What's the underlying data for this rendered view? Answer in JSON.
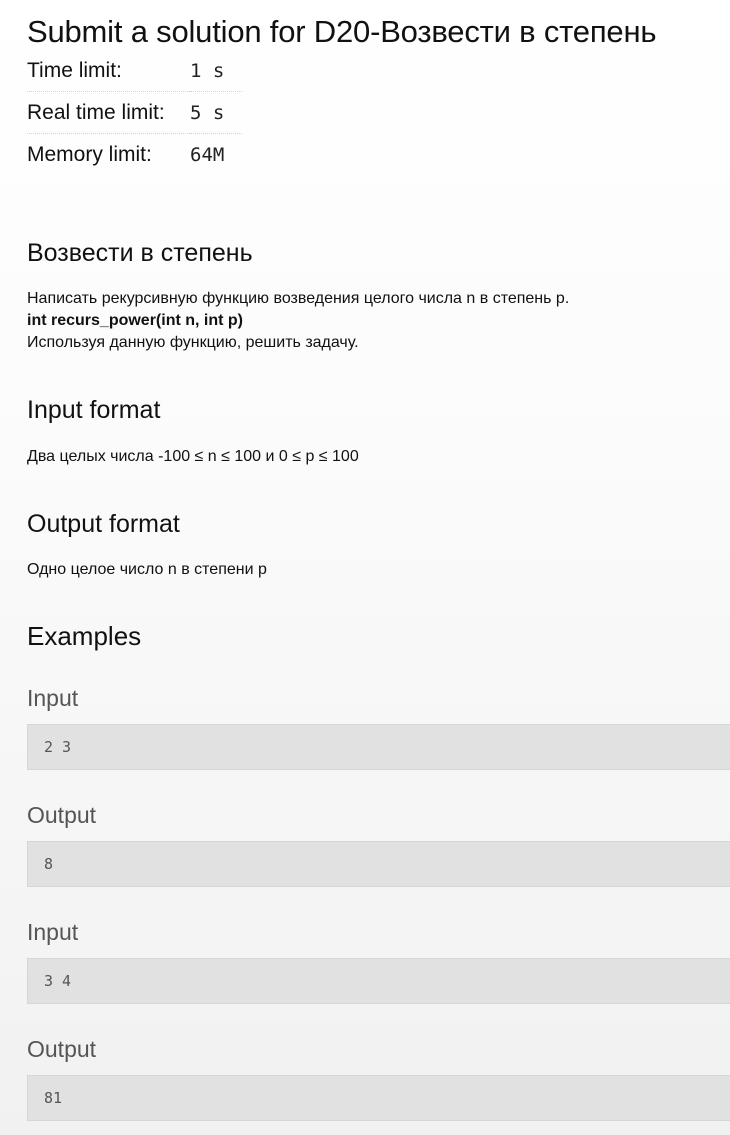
{
  "page_title": "Submit a solution for D20-Возвести в степень",
  "limits": [
    {
      "label": "Time limit:",
      "value": "1 s"
    },
    {
      "label": "Real time limit:",
      "value": "5 s"
    },
    {
      "label": "Memory limit:",
      "value": "64M"
    }
  ],
  "statement": {
    "heading": "Возвести в степень",
    "line1": "Написать рекурсивную функцию возведения целого числа n в степень p.",
    "signature": "int recurs_power(int n, int p)",
    "line3": "Используя данную функцию, решить задачу."
  },
  "input_format": {
    "heading": "Input format",
    "text": "Два целых числа -100 ≤ n ≤ 100 и 0 ≤ p ≤ 100"
  },
  "output_format": {
    "heading": "Output format",
    "text": "Одно целое число n в степени p"
  },
  "examples": {
    "heading": "Examples",
    "items": [
      {
        "label": "Input",
        "value": "2 3"
      },
      {
        "label": "Output",
        "value": "8"
      },
      {
        "label": "Input",
        "value": "3 4"
      },
      {
        "label": "Output",
        "value": "81"
      }
    ]
  }
}
